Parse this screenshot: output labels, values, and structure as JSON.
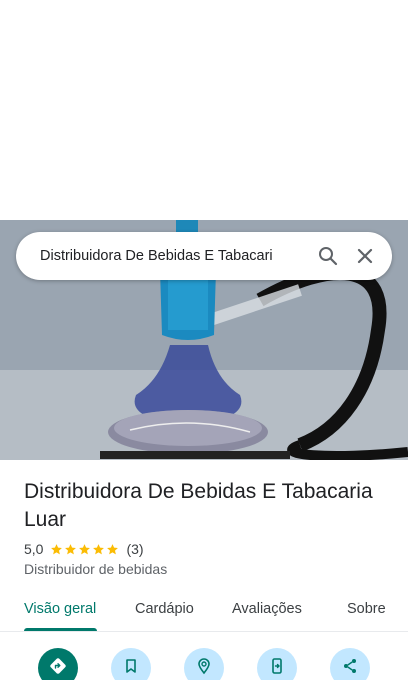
{
  "search": {
    "query": "Distribuidora De Bebidas E Tabacari"
  },
  "place": {
    "name": "Distribuidora De Bebidas E Tabacaria Luar",
    "rating": "5,0",
    "review_count": "(3)",
    "star_count": 5,
    "category": "Distribuidor de bebidas"
  },
  "tabs": [
    {
      "label": "Visão geral",
      "active": true
    },
    {
      "label": "Cardápio",
      "active": false
    },
    {
      "label": "Avaliações",
      "active": false
    },
    {
      "label": "Sobre",
      "active": false
    }
  ],
  "actions": [
    {
      "icon": "directions-icon"
    },
    {
      "icon": "bookmark-icon"
    },
    {
      "icon": "nearby-icon"
    },
    {
      "icon": "send-to-phone-icon"
    },
    {
      "icon": "share-icon"
    }
  ],
  "colors": {
    "accent": "#00796b",
    "action_bg": "#c2e7ff",
    "star": "#fbbc04"
  }
}
